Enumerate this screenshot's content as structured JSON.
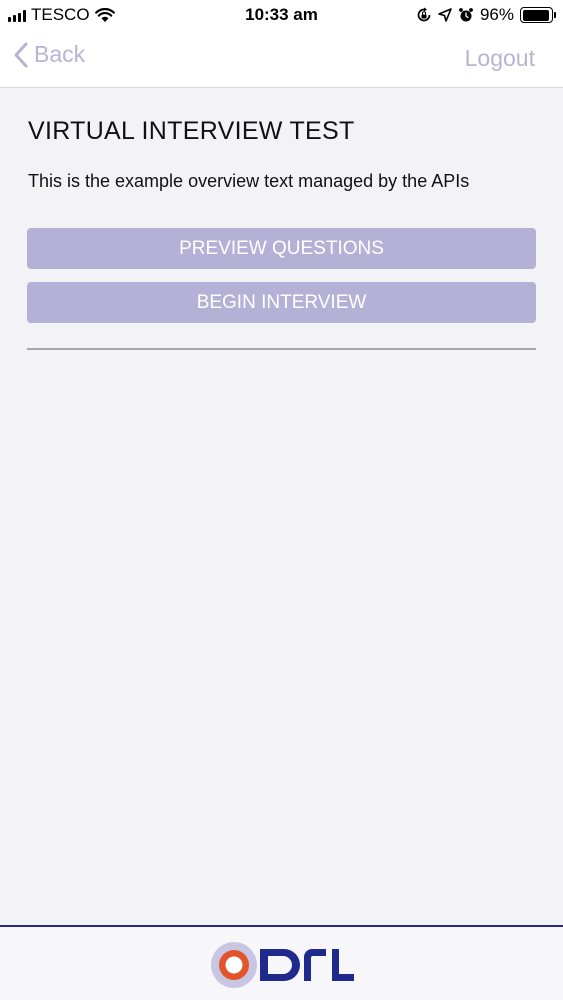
{
  "status_bar": {
    "carrier": "TESCO",
    "time": "10:33 am",
    "battery_percent": "96%",
    "battery_level": 0.96
  },
  "nav": {
    "back_label": "Back",
    "logout_label": "Logout"
  },
  "main": {
    "title": "VIRTUAL INTERVIEW TEST",
    "overview": "This is the example overview text managed by the APIs",
    "preview_label": "PREVIEW QUESTIONS",
    "begin_label": "BEGIN INTERVIEW"
  },
  "colors": {
    "accent": "#b4b1d6",
    "nav_text": "#b7b4d3",
    "footer_rule": "#2a2a86",
    "logo_navy": "#1f2a8c",
    "logo_orange": "#e2542a"
  },
  "icons": {
    "back": "chevron-left-icon",
    "wifi": "wifi-icon",
    "lock_rotation": "rotation-lock-icon",
    "location": "location-arrow-icon",
    "alarm": "alarm-clock-icon",
    "battery": "battery-icon"
  }
}
